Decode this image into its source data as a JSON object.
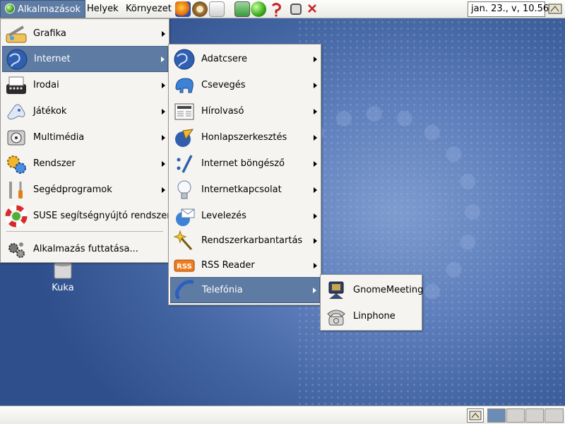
{
  "top_panel": {
    "menus": [
      "Alkalmazások",
      "Helyek",
      "Környezet"
    ],
    "clock": "jan. 23., v, 10.56",
    "launchers": [
      "firefox-icon",
      "compass-icon",
      "document-icon",
      "monitor-icon",
      "green-ball-icon",
      "help-icon",
      "window-list-icon",
      "close-icon"
    ]
  },
  "main_menu": {
    "items": [
      {
        "label": "Grafika",
        "icon": "graphics-icon"
      },
      {
        "label": "Internet",
        "icon": "globe-icon"
      },
      {
        "label": "Irodai",
        "icon": "typewriter-icon"
      },
      {
        "label": "Játékok",
        "icon": "gamepad-icon"
      },
      {
        "label": "Multimédia",
        "icon": "multimedia-icon"
      },
      {
        "label": "Rendszer",
        "icon": "gears-icon"
      },
      {
        "label": "Segédprogramok",
        "icon": "tools-icon"
      },
      {
        "label": "SUSE segítségnyújtó rendszer",
        "icon": "lifebuoy-icon"
      },
      {
        "label": "Alkalmazás futtatása...",
        "icon": "run-icon"
      }
    ]
  },
  "internet_menu": {
    "items": [
      {
        "label": "Adatcsere",
        "icon": "globe-icon"
      },
      {
        "label": "Csevegés",
        "icon": "elephant-icon"
      },
      {
        "label": "Hírolvasó",
        "icon": "newspaper-icon"
      },
      {
        "label": "Honlapszerkesztés",
        "icon": "web-editor-icon"
      },
      {
        "label": "Internet böngésző",
        "icon": "browser-icon"
      },
      {
        "label": "Internetkapcsolat",
        "icon": "lightbulb-icon"
      },
      {
        "label": "Levelezés",
        "icon": "mail-icon"
      },
      {
        "label": "Rendszerkarbantartás",
        "icon": "wand-icon"
      },
      {
        "label": "RSS Reader",
        "icon": "rss-icon"
      },
      {
        "label": "Telefónia",
        "icon": "phone-icon"
      }
    ]
  },
  "telephony_menu": {
    "items": [
      {
        "label": "GnomeMeeting",
        "icon": "gnomemeeting-icon"
      },
      {
        "label": "Linphone",
        "icon": "old-phone-icon"
      }
    ]
  },
  "desktop": {
    "icons": [
      {
        "label": "Kuka",
        "icon": "trash-icon"
      }
    ]
  },
  "colors": {
    "selection": "#5d7ba3",
    "menu_bg": "#f5f4f1",
    "panel_bg": "#ebeae6",
    "desktop": "#4a6aa7"
  }
}
